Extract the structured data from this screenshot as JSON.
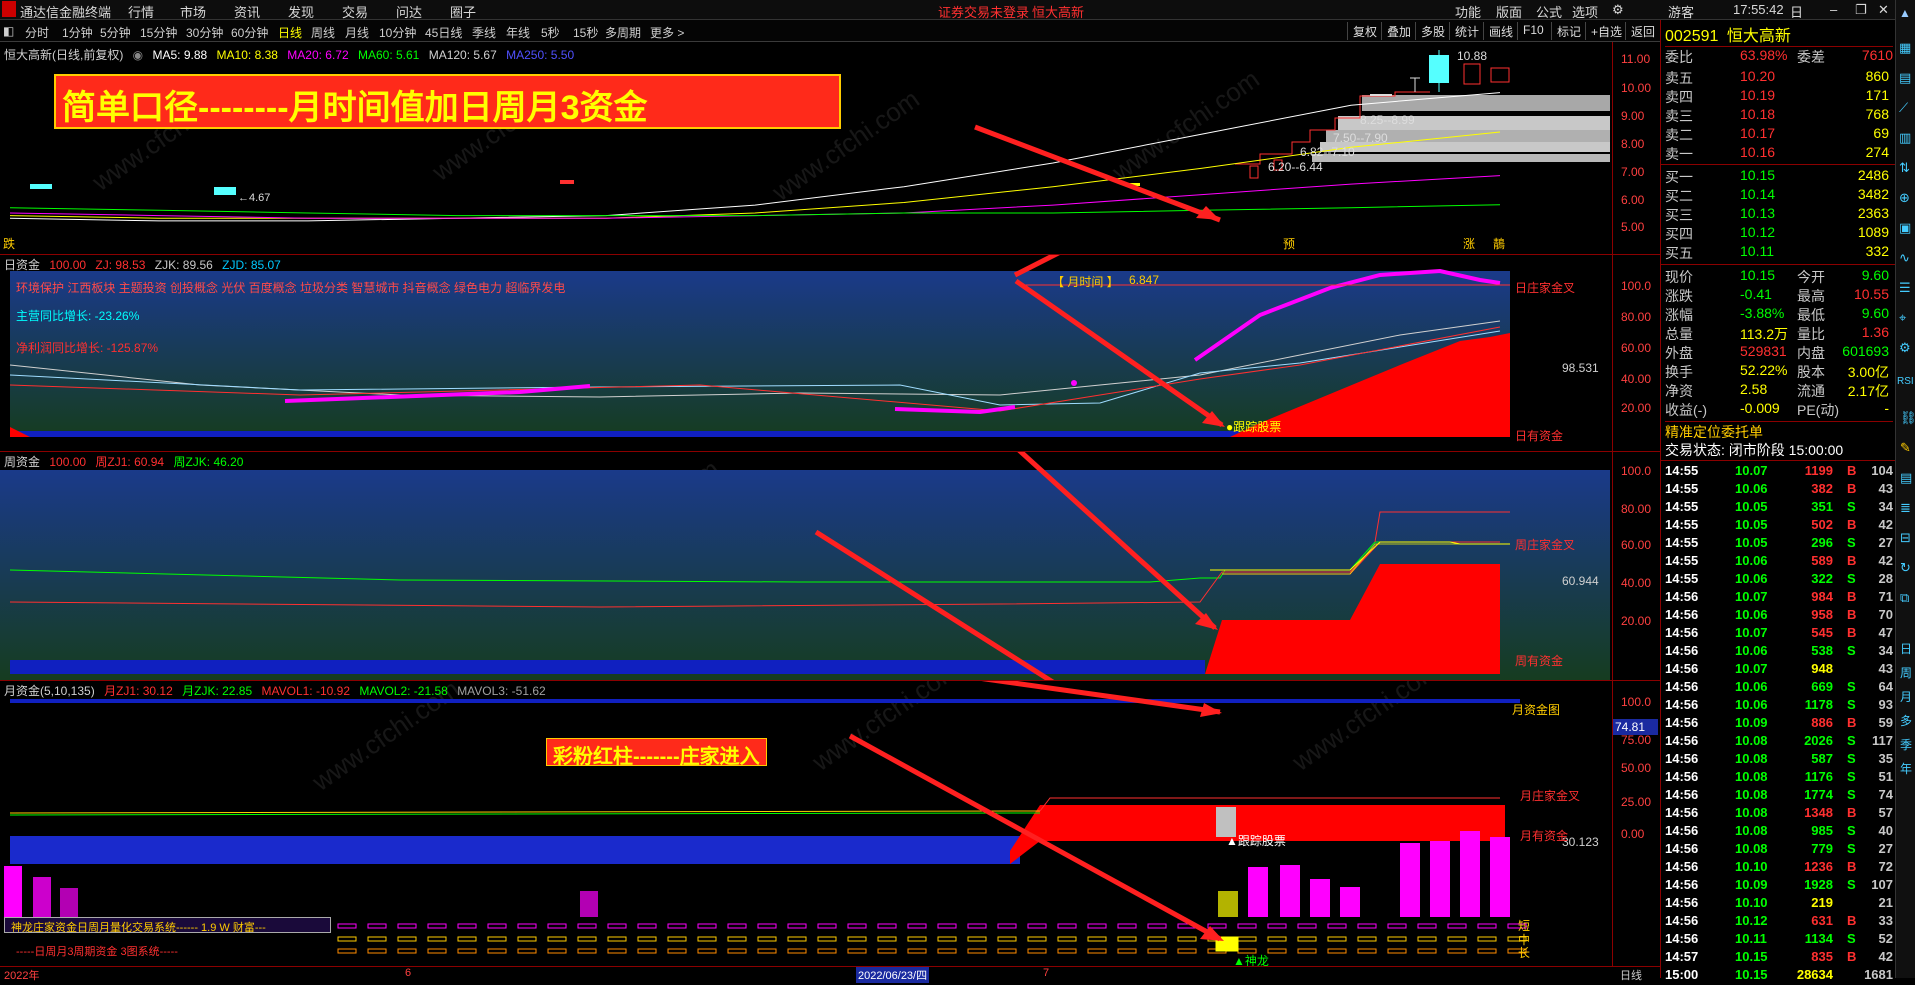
{
  "menubar": {
    "app": "通达信金融终端",
    "items": [
      "行情",
      "市场",
      "资讯",
      "发现",
      "交易",
      "问达",
      "圈子"
    ],
    "status": "证券交易未登录",
    "status_stock": "恒大高新",
    "right": [
      "功能",
      "版面",
      "公式",
      "选项"
    ],
    "user": "游客",
    "time": "17:55:42",
    "weekday": "日"
  },
  "periods": [
    "分时",
    "1分钟",
    "5分钟",
    "15分钟",
    "30分钟",
    "60分钟",
    "日线",
    "周线",
    "月线",
    "10分钟",
    "45日线",
    "季线",
    "年线",
    "5秒",
    "15秒",
    "多周期",
    "更多 >"
  ],
  "active_period": "日线",
  "toolbar": [
    "复权",
    "叠加",
    "多股",
    "统计",
    "画线",
    "F10",
    "标记",
    "+自选",
    "返回"
  ],
  "kline": {
    "title": "恒大高新(日线,前复权)",
    "ma": [
      {
        "label": "MA5: 9.88",
        "color": "#ffffff"
      },
      {
        "label": "MA10: 8.38",
        "color": "#ffff00"
      },
      {
        "label": "MA20: 6.72",
        "color": "#ff00ff"
      },
      {
        "label": "MA60: 5.61",
        "color": "#00ff00"
      },
      {
        "label": "MA120: 5.67",
        "color": "#d0d0d0"
      },
      {
        "label": "MA250: 5.50",
        "color": "#4040ff"
      }
    ],
    "yticks": [
      "11.00",
      "10.00",
      "9.00",
      "8.00",
      "7.00",
      "6.00",
      "5.00"
    ],
    "banner": "简单口径--------月时间值加日周月3资金",
    "price_labels": [
      "10.88",
      "8.25--8.99",
      "7.50--7.90",
      "6.82--7.10",
      "6.20--6.44",
      "4.67"
    ],
    "markers": [
      "跌",
      "预",
      "涨",
      "鶄"
    ]
  },
  "daily": {
    "title": "日资金",
    "values": [
      {
        "label": "100.00",
        "color": "#ff3030"
      },
      {
        "label": "ZJ: 98.53",
        "color": "#ff3030"
      },
      {
        "label": "ZJK: 89.56",
        "color": "#c8c8c8"
      },
      {
        "label": "ZJD: 85.07",
        "color": "#00c8ff"
      }
    ],
    "concepts": "环境保护 江西板块 主题投资 创投概念 光伏 百度概念 垃圾分类 智慧城市 抖音概念 绿色电力 超临界发电",
    "revenue": "主营同比增长: -23.26%",
    "profit": "净利润同比增长: -125.87%",
    "month_time_label": "【 月时间 】",
    "month_time_value": "6.847",
    "value_label": "98.531",
    "track": "●跟踪股票",
    "line1": "日庄家金叉",
    "line2": "日有资金",
    "yticks": [
      "100.0",
      "80.00",
      "60.00",
      "40.00",
      "20.00"
    ]
  },
  "weekly": {
    "title": "周资金",
    "values": [
      {
        "label": "100.00",
        "color": "#ff3030"
      },
      {
        "label": "周ZJ1: 60.94",
        "color": "#ff3030"
      },
      {
        "label": "周ZJK: 46.20",
        "color": "#00ff00"
      }
    ],
    "value_label": "60.944",
    "line1": "周庄家金叉",
    "line2": "周有资金",
    "yticks": [
      "100.0",
      "80.00",
      "60.00",
      "40.00",
      "20.00"
    ]
  },
  "monthly": {
    "title": "月资金(5,10,135)",
    "values": [
      {
        "label": "月ZJ1: 30.12",
        "color": "#ff3030"
      },
      {
        "label": "月ZJK: 22.85",
        "color": "#00ff00"
      },
      {
        "label": "MAVOL1: -10.92",
        "color": "#ff3030"
      },
      {
        "label": "MAVOL2: -21.58",
        "color": "#00ff00"
      },
      {
        "label": "MAVOL3: -51.62",
        "color": "#a0a0a0"
      }
    ],
    "banner": "彩粉红柱-------庄家进入",
    "chart_label": "月资金图",
    "value_box": "74.81",
    "value_label": "30.123",
    "track": "▲跟踪股票",
    "line1": "月庄家金叉",
    "line2": "月有资金",
    "legend": [
      "短",
      "中",
      "长"
    ],
    "system": "神龙庄家资金日周月量化交易系统------ 1.9  W  财富---",
    "system2": "-----日周月3周期资金 3图系统-----",
    "shenlong": "▲神龙",
    "yticks": [
      "100.0",
      "75.00",
      "50.00",
      "25.00",
      "0.00"
    ]
  },
  "dates": {
    "d1": "2022年",
    "d2": "6",
    "d3": "2022/06/23/四",
    "d4": "7",
    "period": "日线"
  },
  "quote": {
    "code": "002591",
    "name": "恒大高新",
    "weibi_label": "委比",
    "weibi": "63.98%",
    "weicha_label": "委差",
    "weicha": "7610",
    "asks": [
      {
        "l": "卖五",
        "p": "10.20",
        "v": "860"
      },
      {
        "l": "卖四",
        "p": "10.19",
        "v": "171"
      },
      {
        "l": "卖三",
        "p": "10.18",
        "v": "768"
      },
      {
        "l": "卖二",
        "p": "10.17",
        "v": "69"
      },
      {
        "l": "卖一",
        "p": "10.16",
        "v": "274"
      }
    ],
    "bids": [
      {
        "l": "买一",
        "p": "10.15",
        "v": "2486"
      },
      {
        "l": "买二",
        "p": "10.14",
        "v": "3482"
      },
      {
        "l": "买三",
        "p": "10.13",
        "v": "2363"
      },
      {
        "l": "买四",
        "p": "10.12",
        "v": "1089"
      },
      {
        "l": "买五",
        "p": "10.11",
        "v": "332"
      }
    ],
    "stats": [
      {
        "a": "现价",
        "av": "10.15",
        "b": "今开",
        "bv": "9.60",
        "ac": "#00ff00",
        "bc": "#00ff00"
      },
      {
        "a": "涨跌",
        "av": "-0.41",
        "b": "最高",
        "bv": "10.55",
        "ac": "#00ff00",
        "bc": "#ff3030"
      },
      {
        "a": "涨幅",
        "av": "-3.88%",
        "b": "最低",
        "bv": "9.60",
        "ac": "#00ff00",
        "bc": "#00ff00"
      },
      {
        "a": "总量",
        "av": "113.2万",
        "b": "量比",
        "bv": "1.36",
        "ac": "#ffff00",
        "bc": "#ff3030"
      },
      {
        "a": "外盘",
        "av": "529831",
        "b": "内盘",
        "bv": "601693",
        "ac": "#ff3030",
        "bc": "#00ff00"
      },
      {
        "a": "换手",
        "av": "52.22%",
        "b": "股本",
        "bv": "3.00亿",
        "ac": "#ffff00",
        "bc": "#ffff00"
      },
      {
        "a": "净资",
        "av": "2.58",
        "b": "流通",
        "bv": "2.17亿",
        "ac": "#ffff00",
        "bc": "#ffff00"
      },
      {
        "a": "收益(-)",
        "av": "-0.009",
        "b": "PE(动)",
        "bv": "-",
        "ac": "#ffff00",
        "bc": "#ffff00"
      }
    ],
    "order_title": "精准定位委托单",
    "trade_state": "交易状态: 闭市阶段 15:00:00",
    "ticks": [
      [
        "14:55",
        "10.07",
        "1199",
        "B",
        "104"
      ],
      [
        "14:55",
        "10.06",
        "382",
        "B",
        "43"
      ],
      [
        "14:55",
        "10.05",
        "351",
        "S",
        "34"
      ],
      [
        "14:55",
        "10.05",
        "502",
        "B",
        "42"
      ],
      [
        "14:55",
        "10.05",
        "296",
        "S",
        "27"
      ],
      [
        "14:55",
        "10.06",
        "589",
        "B",
        "42"
      ],
      [
        "14:55",
        "10.06",
        "322",
        "S",
        "28"
      ],
      [
        "14:56",
        "10.07",
        "984",
        "B",
        "71"
      ],
      [
        "14:56",
        "10.06",
        "958",
        "B",
        "70"
      ],
      [
        "14:56",
        "10.07",
        "545",
        "B",
        "47"
      ],
      [
        "14:56",
        "10.06",
        "538",
        "S",
        "34"
      ],
      [
        "14:56",
        "10.07",
        "948",
        "",
        "43"
      ],
      [
        "14:56",
        "10.06",
        "669",
        "S",
        "64"
      ],
      [
        "14:56",
        "10.06",
        "1178",
        "S",
        "93"
      ],
      [
        "14:56",
        "10.09",
        "886",
        "B",
        "59"
      ],
      [
        "14:56",
        "10.08",
        "2026",
        "S",
        "117"
      ],
      [
        "14:56",
        "10.08",
        "587",
        "S",
        "35"
      ],
      [
        "14:56",
        "10.08",
        "1176",
        "S",
        "51"
      ],
      [
        "14:56",
        "10.08",
        "1774",
        "S",
        "74"
      ],
      [
        "14:56",
        "10.08",
        "1348",
        "B",
        "57"
      ],
      [
        "14:56",
        "10.08",
        "985",
        "S",
        "40"
      ],
      [
        "14:56",
        "10.08",
        "779",
        "S",
        "27"
      ],
      [
        "14:56",
        "10.10",
        "1236",
        "B",
        "72"
      ],
      [
        "14:56",
        "10.09",
        "1928",
        "S",
        "107"
      ],
      [
        "14:56",
        "10.10",
        "219",
        "",
        "21"
      ],
      [
        "14:56",
        "10.12",
        "631",
        "B",
        "33"
      ],
      [
        "14:56",
        "10.11",
        "1134",
        "S",
        "52"
      ],
      [
        "14:57",
        "10.15",
        "835",
        "B",
        "42"
      ],
      [
        "15:00",
        "10.15",
        "28634",
        "",
        "1681"
      ]
    ]
  },
  "side_tools": [
    "RSI",
    "日",
    "周",
    "月",
    "多",
    "季",
    "年"
  ],
  "watermark": "www.cfchi.com",
  "chart_data": {
    "type": "line",
    "title": "恒大高新(日线,前复权)",
    "ylim": [
      4.5,
      11.5
    ],
    "series": [
      {
        "name": "MA5",
        "values": [
          5.1,
          5.0,
          5.0,
          5.1,
          5.2,
          5.6,
          6.3,
          7.2,
          8.3,
          9.4,
          9.88
        ]
      },
      {
        "name": "MA10",
        "values": [
          5.2,
          5.1,
          5.1,
          5.1,
          5.1,
          5.3,
          5.7,
          6.3,
          7.0,
          7.8,
          8.38
        ]
      },
      {
        "name": "MA20",
        "values": [
          5.3,
          5.2,
          5.1,
          5.1,
          5.1,
          5.2,
          5.3,
          5.6,
          6.0,
          6.4,
          6.72
        ]
      },
      {
        "name": "MA60",
        "values": [
          5.5,
          5.4,
          5.3,
          5.2,
          5.2,
          5.2,
          5.3,
          5.3,
          5.4,
          5.5,
          5.61
        ]
      }
    ]
  }
}
